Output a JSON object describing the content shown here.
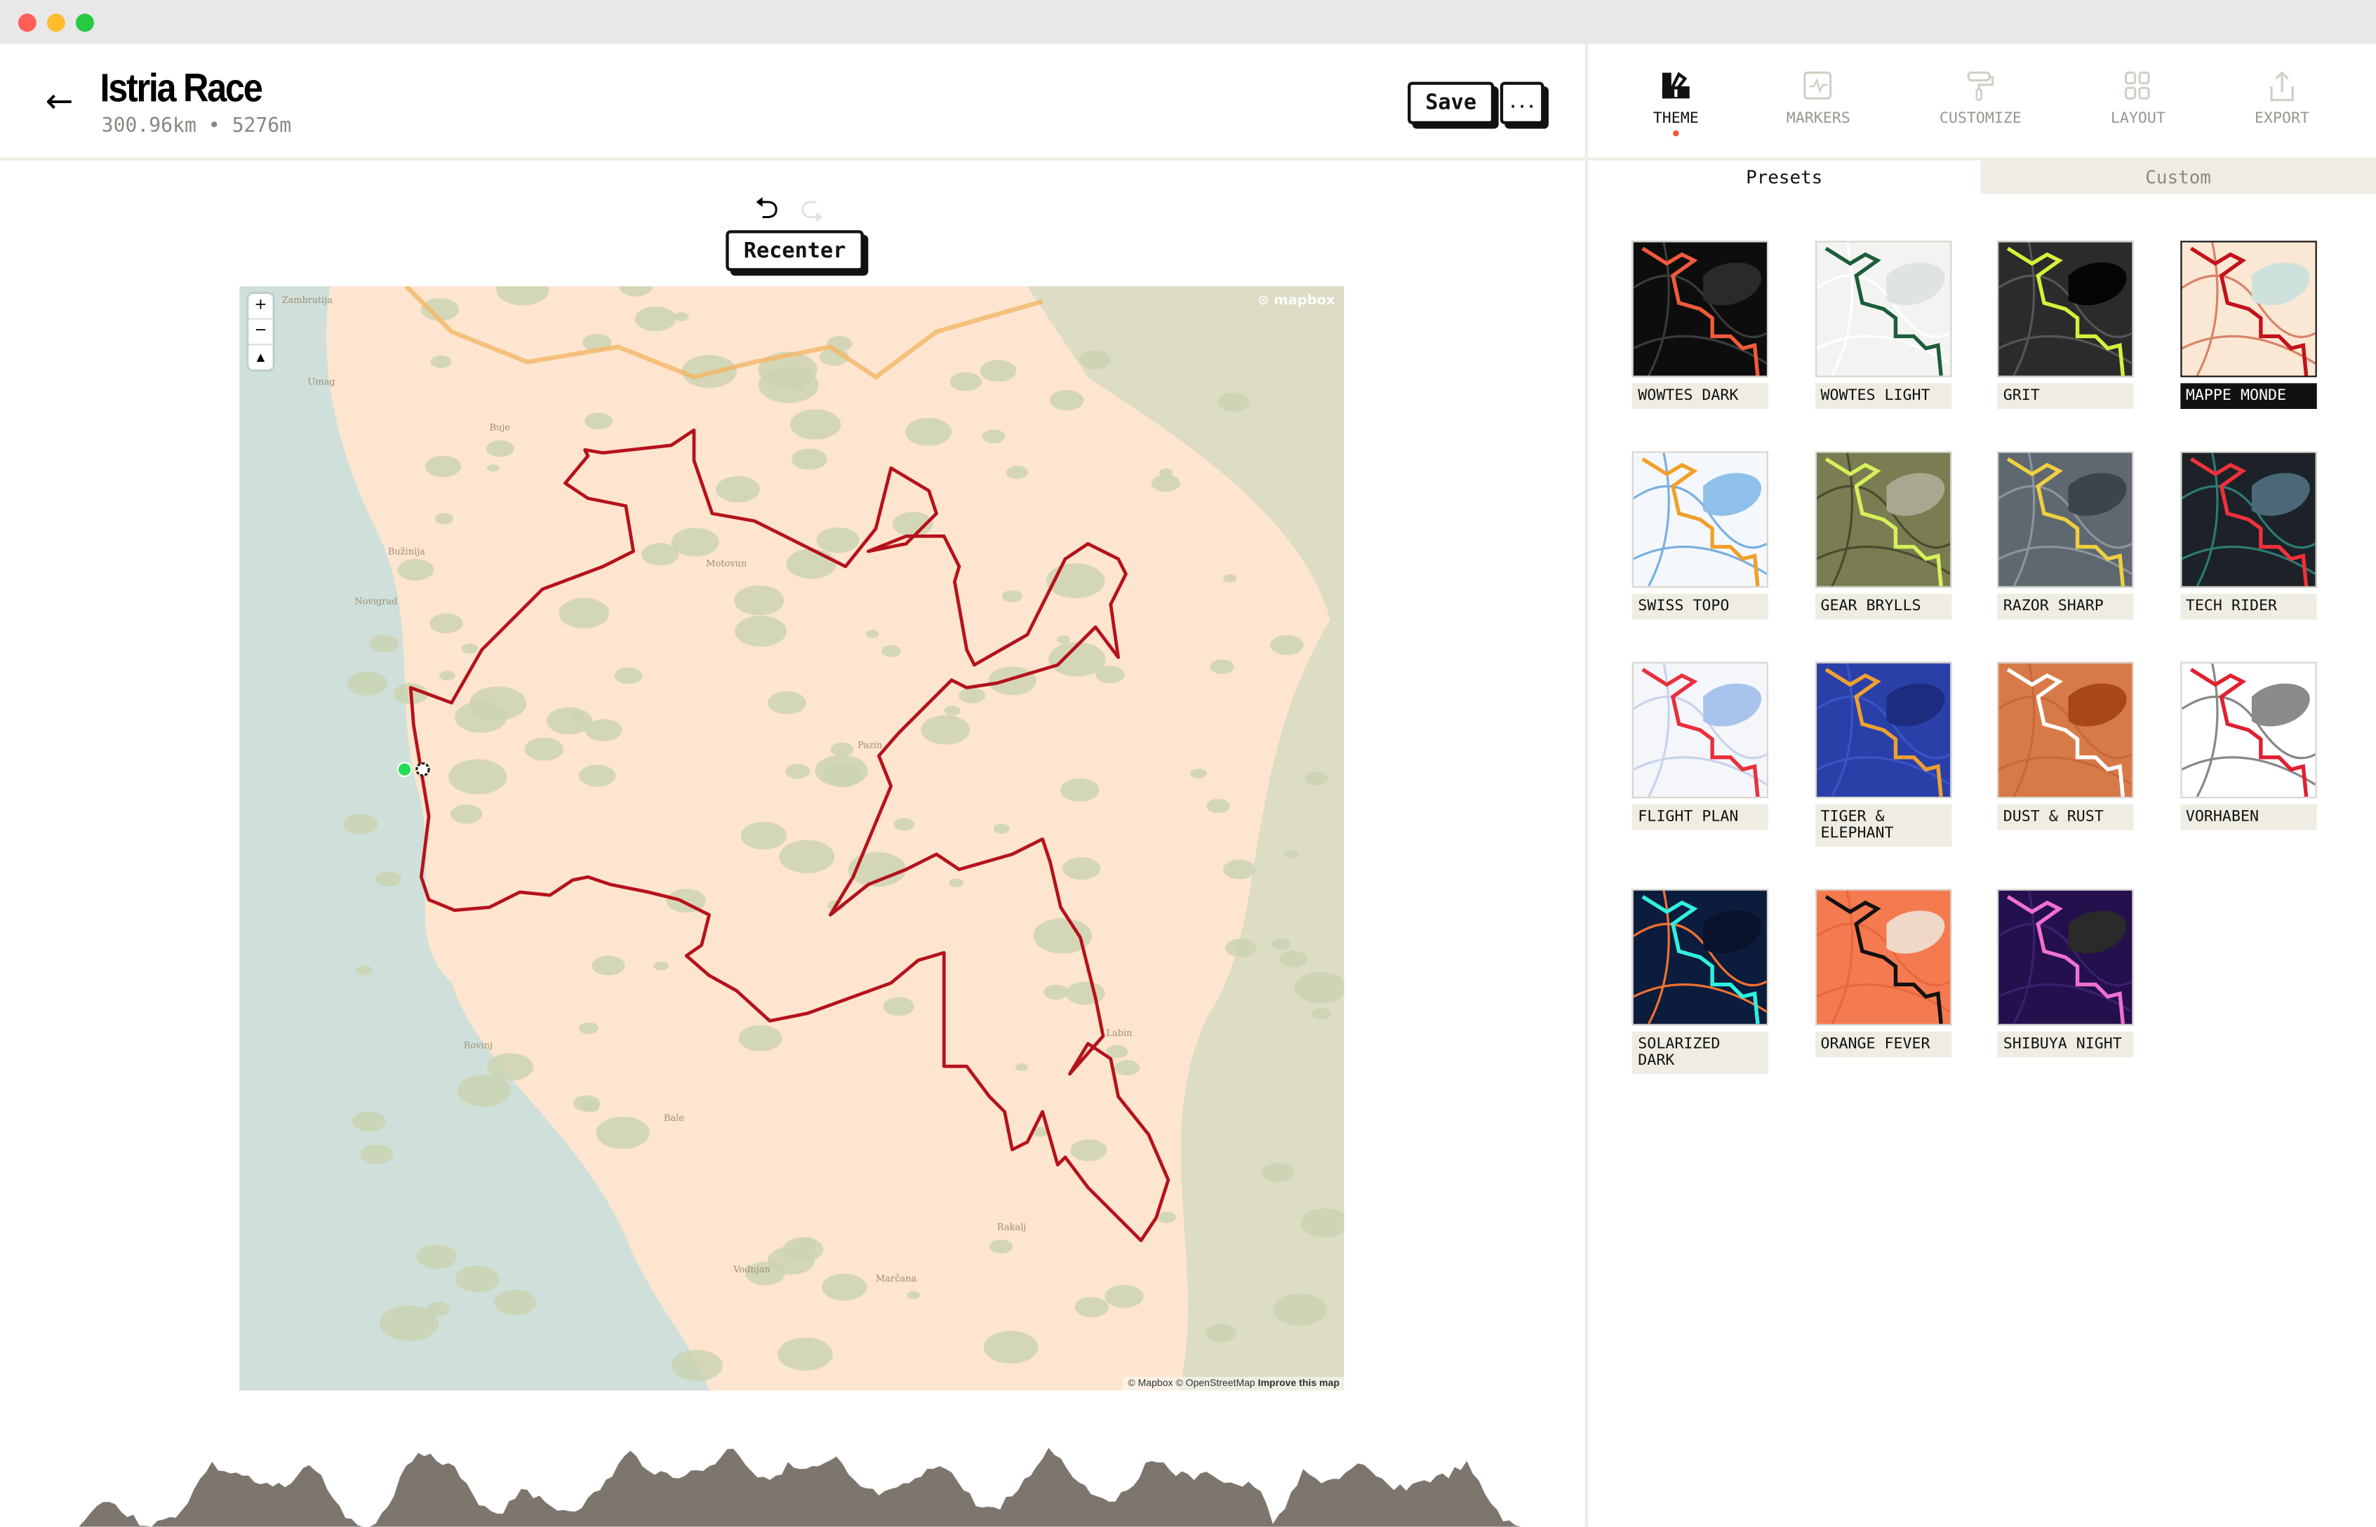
{
  "window": {
    "buttons": [
      "close",
      "minimize",
      "maximize"
    ],
    "colors": [
      "#fe5f57",
      "#febc2e",
      "#28c840"
    ]
  },
  "header": {
    "back_icon": "arrow-left-icon",
    "title": "Istria Race",
    "stats": "300.96km • 5276m",
    "save_label": "Save",
    "more_label": "..."
  },
  "toolbar": {
    "undo_icon": "undo-icon",
    "redo_icon": "redo-icon",
    "recenter_label": "Recenter"
  },
  "map": {
    "zoom_in": "+",
    "zoom_out": "−",
    "compass": "▲",
    "logo": "mapbox",
    "attribution": "© Mapbox © OpenStreetMap",
    "improve": "Improve this map",
    "route_color": "#b5121b",
    "places": [
      "Zambratija",
      "Umag",
      "Buje",
      "Bužinija",
      "Novigrad",
      "Motovun",
      "Pazin",
      "Rovinj",
      "Bale",
      "Vodnjan",
      "Marčana",
      "Labin",
      "Rakalj"
    ]
  },
  "panel": {
    "tabs": [
      {
        "label": "THEME",
        "icon": "swatch-icon",
        "active": true
      },
      {
        "label": "MARKERS",
        "icon": "marker-chart-icon"
      },
      {
        "label": "CUSTOMIZE",
        "icon": "paint-roller-icon"
      },
      {
        "label": "LAYOUT",
        "icon": "layout-grid-icon"
      },
      {
        "label": "EXPORT",
        "icon": "share-icon"
      }
    ],
    "subtabs": {
      "presets": "Presets",
      "custom": "Custom",
      "active": "Presets"
    },
    "selected_theme": "MAPPE MONDE",
    "themes": [
      {
        "name": "WOWTES DARK",
        "bg": "#0d0d0d",
        "line": "#f05a3c",
        "accent": "#3a3a3a",
        "blob": "#2a2a2a"
      },
      {
        "name": "WOWTES LIGHT",
        "bg": "#f3f3f1",
        "line": "#1c5e3a",
        "accent": "#ffffff",
        "blob": "#e0e4e1"
      },
      {
        "name": "GRIT",
        "bg": "#2b2b2b",
        "line": "#d8f03c",
        "accent": "#555",
        "blob": "#050505"
      },
      {
        "name": "MAPPE MONDE",
        "bg": "#fbe8d4",
        "line": "#c3121b",
        "accent": "#d9846a",
        "blob": "#cfe1dc"
      },
      {
        "name": "SWISS TOPO",
        "bg": "#f4f8fc",
        "line": "#f0a02a",
        "accent": "#7ab0e0",
        "blob": "#8ec0ea"
      },
      {
        "name": "GEAR BRYLLS",
        "bg": "#7a7c52",
        "line": "#d8f05a",
        "accent": "#4a4c30",
        "blob": "#a8a890"
      },
      {
        "name": "RAZOR SHARP",
        "bg": "#5f6870",
        "line": "#f0d040",
        "accent": "#8a949c",
        "blob": "#3c444c"
      },
      {
        "name": "TECH RIDER",
        "bg": "#1c2228",
        "line": "#f0303c",
        "accent": "#2c7a74",
        "blob": "#4a6878"
      },
      {
        "name": "FLIGHT PLAN",
        "bg": "#f4f6fa",
        "line": "#e8303c",
        "accent": "#c8d4ec",
        "blob": "#a8c4ec"
      },
      {
        "name": "TIGER & ELEPHANT",
        "bg": "#2a40a8",
        "line": "#f0a030",
        "accent": "#3a54c4",
        "blob": "#1c2c80"
      },
      {
        "name": "DUST & RUST",
        "bg": "#d87a48",
        "line": "#ffffff",
        "accent": "#c86838",
        "blob": "#a84818"
      },
      {
        "name": "VORHABEN",
        "bg": "#ffffff",
        "line": "#e02030",
        "accent": "#888",
        "blob": "#8a8a8a"
      },
      {
        "name": "SOLARIZED DARK",
        "bg": "#0c1c3c",
        "line": "#30f0e0",
        "accent": "#f07030",
        "blob": "#08122a"
      },
      {
        "name": "ORANGE FEVER",
        "bg": "#f47a50",
        "line": "#111111",
        "accent": "#e86840",
        "blob": "#f0d8c8"
      },
      {
        "name": "SHIBUYA NIGHT",
        "bg": "#24104c",
        "line": "#f070d0",
        "accent": "#3a2070",
        "blob": "#2a2a2a"
      }
    ]
  },
  "elevation": {
    "color": "#7d766e"
  }
}
